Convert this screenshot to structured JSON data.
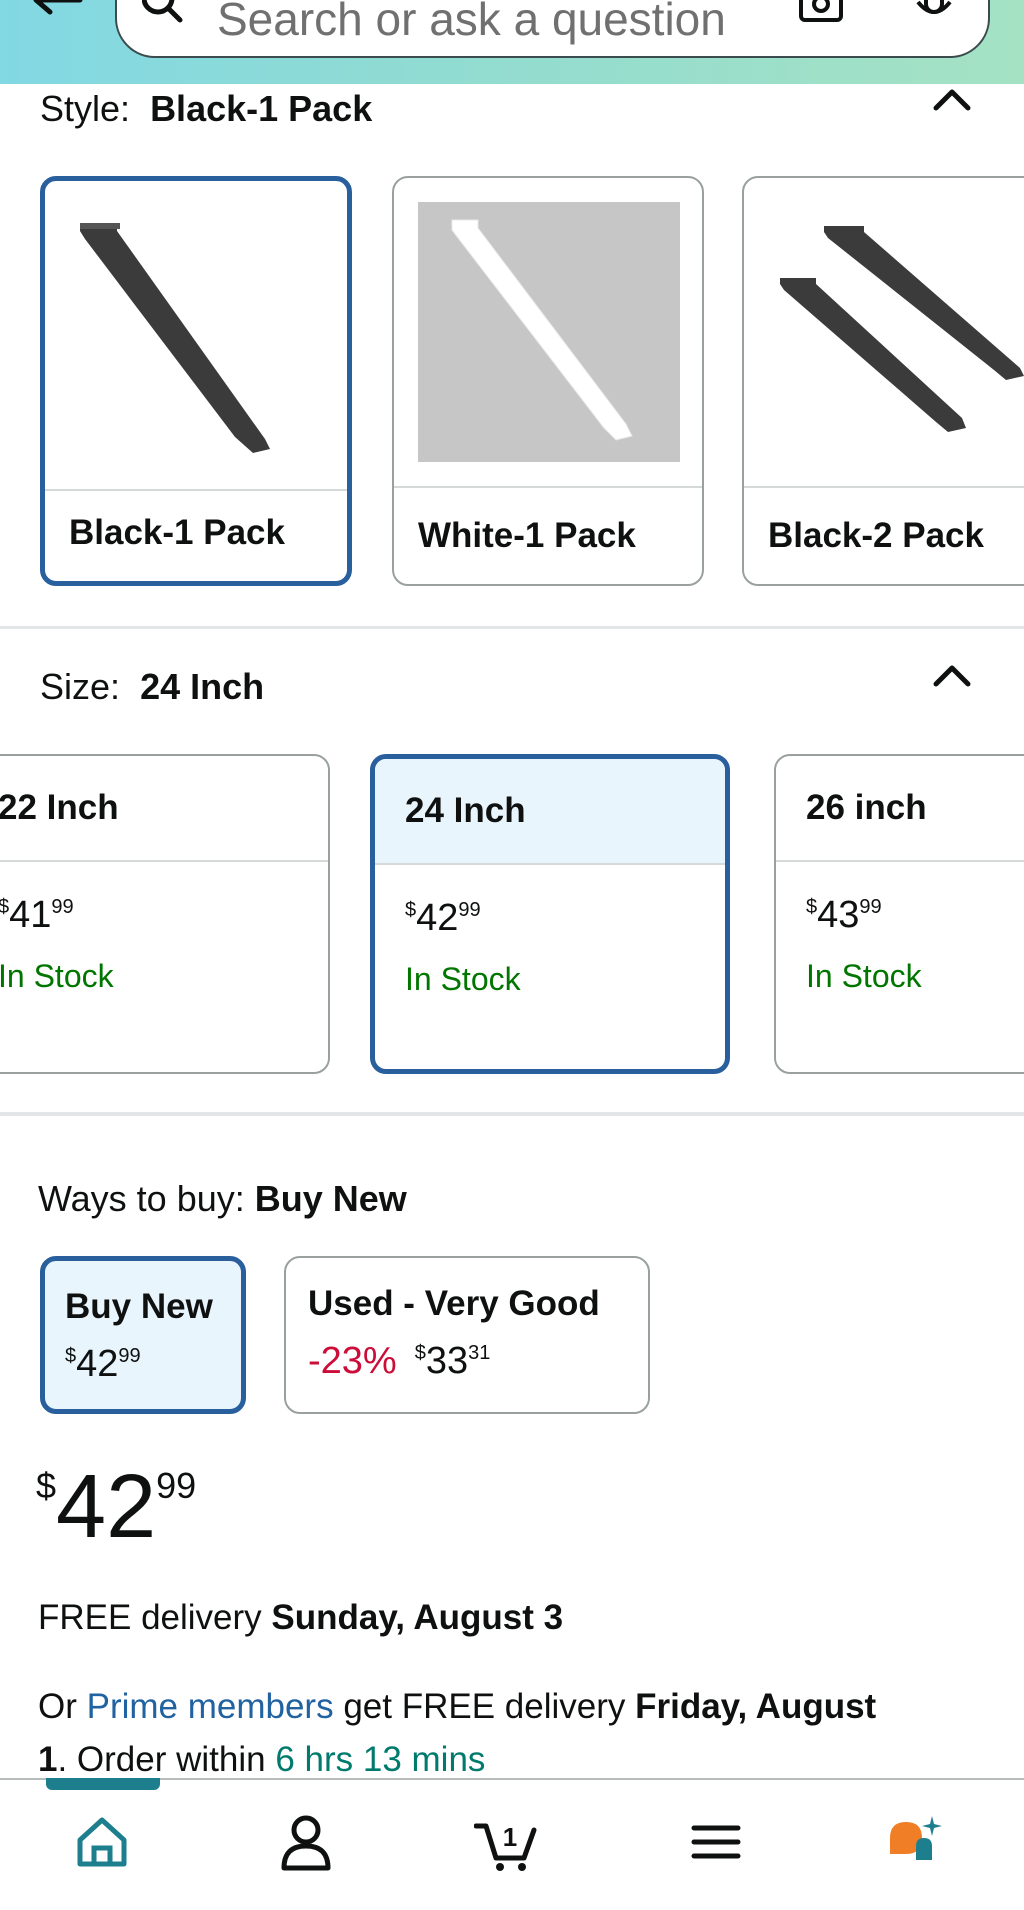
{
  "search": {
    "placeholder": "Search or ask a question"
  },
  "style_section": {
    "label": "Style:",
    "selected_value": "Black-1 Pack",
    "options": [
      {
        "label": "Black-1 Pack",
        "selected": true
      },
      {
        "label": "White-1 Pack",
        "selected": false
      },
      {
        "label": "Black-2 Pack",
        "selected": false
      }
    ]
  },
  "size_section": {
    "label": "Size:",
    "selected_value": "24 Inch",
    "options": [
      {
        "name": "22 Inch",
        "currency": "$",
        "dollars": "41",
        "cents": "99",
        "stock": "In Stock",
        "selected": false
      },
      {
        "name": "24 Inch",
        "currency": "$",
        "dollars": "42",
        "cents": "99",
        "stock": "In Stock",
        "selected": true
      },
      {
        "name": "26 inch",
        "currency": "$",
        "dollars": "43",
        "cents": "99",
        "stock": "In Stock",
        "selected": false
      }
    ]
  },
  "ways_to_buy": {
    "label": "Ways to buy:",
    "selected_value": "Buy New",
    "options": [
      {
        "title": "Buy New",
        "currency": "$",
        "dollars": "42",
        "cents": "99",
        "selected": true
      },
      {
        "title": "Used - Very Good",
        "discount": "-23%",
        "currency": "$",
        "dollars": "33",
        "cents": "31",
        "selected": false
      }
    ]
  },
  "price": {
    "currency": "$",
    "dollars": "42",
    "cents": "99"
  },
  "delivery": {
    "prefix": "FREE delivery ",
    "date": "Sunday, August 3"
  },
  "prime": {
    "or": "Or ",
    "link": "Prime members",
    "middle": " get FREE delivery ",
    "date_part1": "Friday, August",
    "date_part2": "1",
    "order_prefix": ". Order within ",
    "countdown": "6 hrs 13 mins"
  },
  "bottom_nav": {
    "items": [
      "home-icon",
      "account-icon",
      "cart-icon",
      "menu-icon",
      "ai-assistant-icon"
    ],
    "cart_count": "1",
    "active_color": "#1d7f8d"
  },
  "colors": {
    "selected_border": "#2a5f9e",
    "in_stock": "#007600",
    "discount": "#cc0c39",
    "link": "#2162a1",
    "countdown": "#007a6c"
  }
}
